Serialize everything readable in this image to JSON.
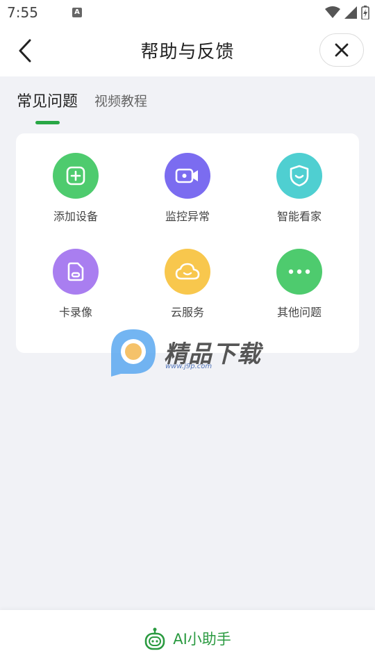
{
  "status_bar": {
    "time": "7:55",
    "notification_icon": "A"
  },
  "header": {
    "title": "帮助与反馈"
  },
  "tabs": [
    {
      "label": "常见问题",
      "active": true
    },
    {
      "label": "视频教程",
      "active": false
    }
  ],
  "grid": [
    {
      "label": "添加设备",
      "icon": "add-icon",
      "color": "#4ecb6e"
    },
    {
      "label": "监控异常",
      "icon": "camera-icon",
      "color": "#7b6cf0"
    },
    {
      "label": "智能看家",
      "icon": "shield-icon",
      "color": "#4fcfd1"
    },
    {
      "label": "卡录像",
      "icon": "sd-card-icon",
      "color": "#a97ef0"
    },
    {
      "label": "云服务",
      "icon": "cloud-icon",
      "color": "#f8c74d"
    },
    {
      "label": "其他问题",
      "icon": "more-icon",
      "color": "#4ecb6e"
    }
  ],
  "watermark": {
    "text": "精品下载",
    "url": "www.j9p.com"
  },
  "bottom": {
    "ai_label": "AI小助手"
  },
  "colors": {
    "accent": "#28a745",
    "background": "#f1f2f6"
  }
}
